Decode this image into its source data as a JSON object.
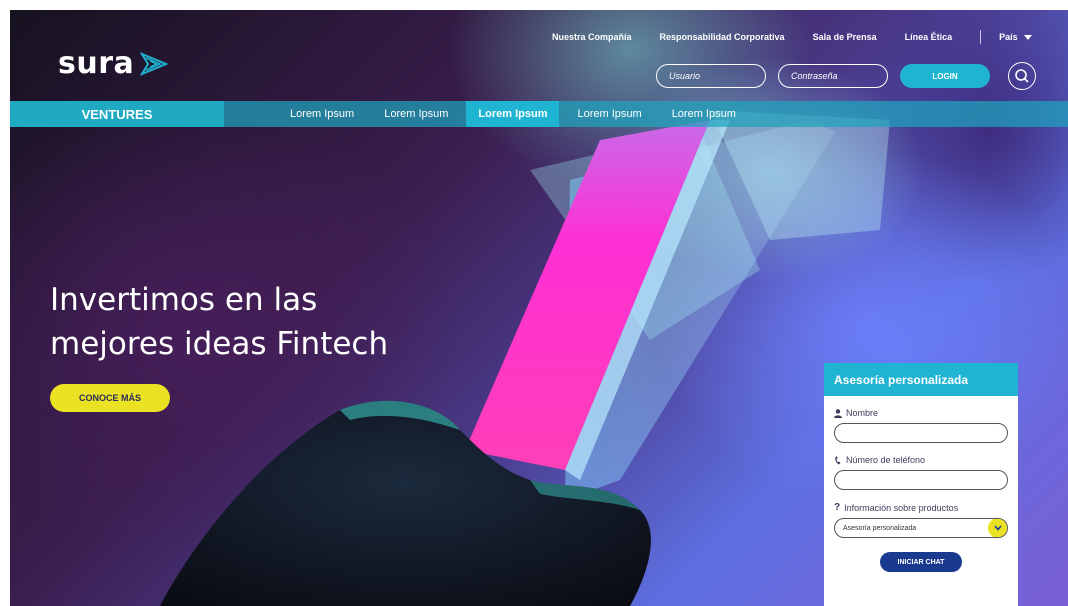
{
  "brand": {
    "logo_text": "sura"
  },
  "utility_nav": {
    "items": [
      "Nuestra Compañía",
      "Responsabilidad Corporativa",
      "Sala de Prensa",
      "Línea Ética"
    ],
    "country_label": "País"
  },
  "login": {
    "user_placeholder": "Usuario",
    "password_placeholder": "Contraseña",
    "button_label": "LOGIN"
  },
  "main_nav": {
    "section_label": "VENTURES",
    "items": [
      "Lorem Ipsum",
      "Lorem Ipsum",
      "Lorem Ipsum",
      "Lorem Ipsum",
      "Lorem Ipsum"
    ],
    "active_index": 2
  },
  "hero": {
    "title_line1": "Invertimos en las",
    "title_line2": "mejores ideas Fintech",
    "cta_label": "CONOCE MÁS"
  },
  "chat": {
    "title": "Asesoría personalizada",
    "name_label": "Nombre",
    "phone_label": "Número de teléfono",
    "info_label": "Información sobre productos",
    "info_selected": "Asesoría personalizada",
    "button_label": "INICIAR CHAT"
  },
  "icons": [
    "user-icon",
    "phone-icon",
    "question-icon",
    "search-icon",
    "chevron-down-icon",
    "caret-down-icon",
    "logo-wing-icon"
  ],
  "colors": {
    "accent": "#1fb4d2",
    "cta": "#ece224",
    "chat_button": "#1a3a8f"
  }
}
